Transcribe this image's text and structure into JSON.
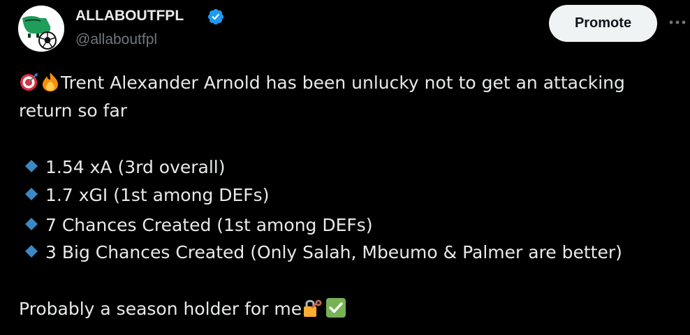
{
  "author": {
    "display_name": "ALLABOUTFPL",
    "handle": "@allaboutfpl",
    "avatar_icon": "football-boot-and-ball-icon",
    "verified_icon": "verified-badge-icon"
  },
  "actions": {
    "promote_label": "Promote",
    "more_icon": "more-options-icon"
  },
  "tweet": {
    "lead_emojis": [
      "direct-hit-icon",
      "fire-icon"
    ],
    "line1": "Trent Alexander Arnold has been unlucky not to get an attacking",
    "line2": "return so far",
    "bullet_icon": "small-blue-diamond-icon",
    "bullets": [
      "1.54 xA (3rd overall)",
      "1.7 xGI (1st among DEFs)",
      "7 Chances Created (1st among DEFs)",
      "3 Big Chances Created (Only Salah, Mbeumo & Palmer are better)"
    ],
    "closing": "Probably a season holder for me",
    "closing_emojis": [
      "locked-with-key-icon",
      "check-mark-button-icon"
    ]
  },
  "colors": {
    "background": "#000000",
    "primary_text": "#e7e9ea",
    "secondary_text": "#71767b",
    "verified_blue": "#1d9bf0",
    "promote_bg": "#eff3f4",
    "bullet_blue": "#3b88c3",
    "check_green": "#77b255"
  }
}
